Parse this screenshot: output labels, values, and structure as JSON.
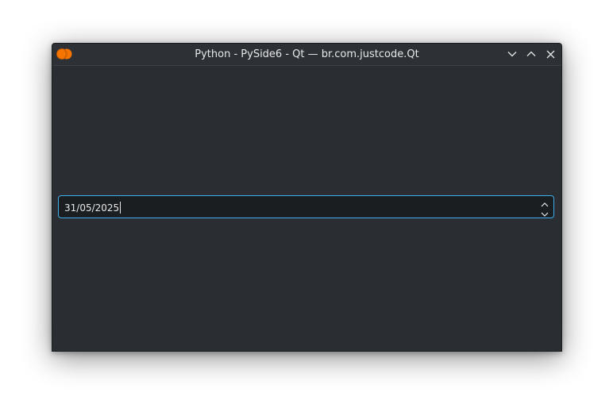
{
  "window": {
    "title": "Python - PySide6 - Qt — br.com.justcode.Qt",
    "app_icon": "python-app-icon",
    "controls": {
      "minimize_icon": "chevron-down-icon",
      "maximize_icon": "chevron-up-icon",
      "close_icon": "close-icon"
    }
  },
  "date_edit": {
    "value": "31/05/2025",
    "spin_up_icon": "chevron-up-icon",
    "spin_down_icon": "chevron-down-icon"
  },
  "colors": {
    "window_background": "#2a2e32",
    "titlebar_background": "#2d3136",
    "field_background": "#1b1e20",
    "focus_border": "#3daee9",
    "text": "#e6e8ea",
    "app_icon_orange": "#f67400"
  }
}
